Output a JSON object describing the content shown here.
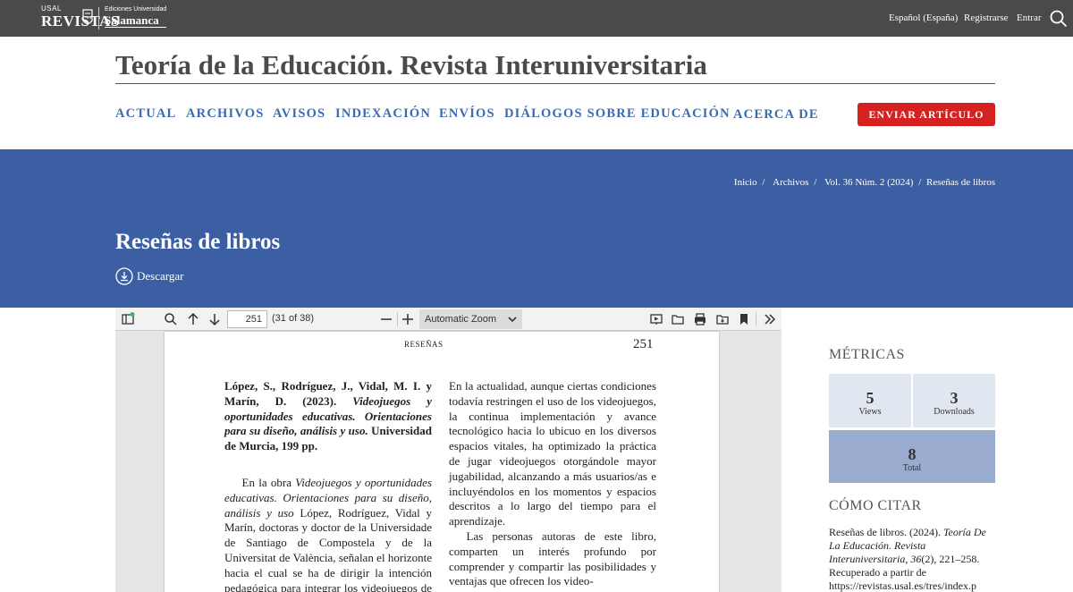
{
  "topbar": {
    "logo_usal_small": "USAL",
    "logo_usal_big": "REVISTAS",
    "logo_ed_small": "Ediciones Universidad",
    "logo_ed_big": "Salamanca",
    "language": "Español (España)",
    "register": "Registrarse",
    "login": "Entrar",
    "search_icon": "search-icon"
  },
  "header": {
    "journal_title": "Teoría de la Educación. Revista Interuniversitaria",
    "nav": [
      "ACTUAL",
      "ARCHIVOS",
      "AVISOS",
      "INDEXACIÓN",
      "ENVÍOS",
      "DIÁLOGOS SOBRE EDUCACIÓN",
      "ACERCA DE"
    ],
    "submit_button": "ENVIAR ARTÍCULO"
  },
  "breadcrumb": [
    "Inicio",
    "Archivos",
    "Vol. 36 Núm. 2 (2024)",
    "Reseñas de libros"
  ],
  "breadcrumb_sep": "/",
  "article": {
    "title": "Reseñas de libros",
    "download_label": "Descargar"
  },
  "viewer": {
    "page_value": "251",
    "page_count": "(31 of 38)",
    "zoom": "Automatic Zoom",
    "pdf": {
      "running_head": "RESEÑAS",
      "page_number": "251",
      "reference_plain1": "López, S., Rodríguez, J., Vidal, M. I. y Marín, D. (2023). ",
      "reference_italic": "Videojuegos y oportunidades educativas. Orientaciones para su diseño, análisis y uso.",
      "reference_plain2": " Universidad de Murcia, 199 pp.",
      "left_body_start": "En la obra ",
      "left_body_italic": "Videojuegos y oportunidades educativas. Orientaciones para su diseño, análisis y uso",
      "left_body_rest": " López, Rodríguez, Vidal y Marín, doctoras y doctor de la Universidade de Santiago de Compostela y de la Universitat de València, señalan el horizonte hacia el cual se ha de dirigir la intención pedagógica para integrar los videojuegos de forma",
      "right_p1": "En la actualidad, aunque ciertas condiciones todavía restringen el uso de los videojuegos, la continua implementación y avance tecnológico hacia lo ubicuo en los diversos espacios vitales, ha optimizado la práctica de jugar videojuegos otorgándole mayor jugabilidad, alcanzando a más usuarios/as e incluyéndolos en los momentos y espacios descritos a lo largo del tiempo para el aprendizaje.",
      "right_p2": "Las personas autoras de este libro, comparten un interés profundo por comprender y compartir las posibilidades y ventajas que ofrecen los video-"
    }
  },
  "sidebar": {
    "metrics_heading": "MÉTRICAS",
    "views_value": "5",
    "views_label": "Views",
    "downloads_value": "3",
    "downloads_label": "Downloads",
    "total_value": "8",
    "total_label": "Total",
    "cite_heading": "CÓMO CITAR",
    "cite_plain1": "Reseñas de libros. (2024). ",
    "cite_italic1": "Teoría De La Educación. Revista Interuniversitaria",
    "cite_plain2": ", ",
    "cite_italic2": "36",
    "cite_plain3": "(2), 221–258. Recuperado a partir de https://revistas.usal.es/tres/index.p"
  },
  "colors": {
    "topbar": "#4a4a4a",
    "nav_link": "#3a6ab0",
    "submit_button": "#d52221",
    "band": "#3c5fa3",
    "metric_box": "#e1e7f1",
    "metric_total": "#99abcf"
  }
}
